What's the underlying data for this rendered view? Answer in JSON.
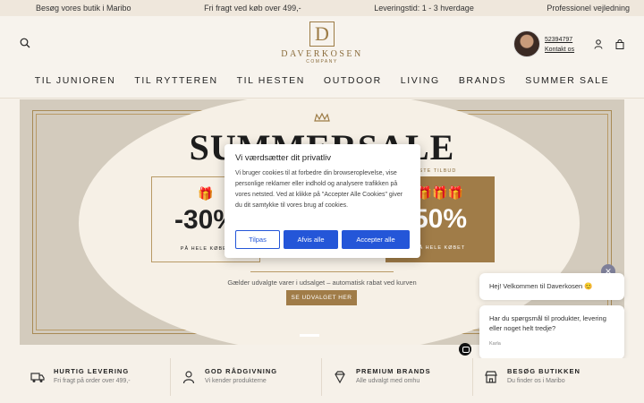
{
  "topbar": [
    "Besøg vores butik i Maribo",
    "Fri fragt ved køb over 499,-",
    "Leveringstid: 1 - 3 hverdage",
    "Professionel vejledning"
  ],
  "logo": {
    "mark": "D",
    "name": "DAVERKOSEN",
    "sub": "COMPANY"
  },
  "contact": {
    "phone": "52394797",
    "link": "Kontakt os"
  },
  "icons": {
    "search": "search-icon",
    "user": "user-icon",
    "cart": "cart-icon"
  },
  "nav": [
    "TIL JUNIOREN",
    "TIL RYTTEREN",
    "TIL HESTEN",
    "OUTDOOR",
    "LIVING",
    "BRANDS",
    "SUMMER SALE"
  ],
  "hero": {
    "title": "SUMMERSALE",
    "left_icon": "🎁",
    "left_value": "-30%",
    "left_caption": "PÅ HELE KØBET",
    "right_tag": "EDSTE TILBUD",
    "right_icon": "🎁🎁🎁",
    "right_value": "50%",
    "right_caption": "PÅ HELE KØBET",
    "note": "Gælder udvalgte varer i udsalget – automatisk rabat ved kurven",
    "cta": "SE UDVALGET HER"
  },
  "cookie": {
    "title": "Vi værdsætter dit privatliv",
    "body": "Vi bruger cookies til at forbedre din browseroplevelse, vise personlige reklamer eller indhold og analysere trafikken på vores netsted. Ved at klikke på \"Accepter Alle Cookies\" giver du dit samtykke til vores brug af cookies.",
    "customize": "Tilpas",
    "deny": "Afvis alle",
    "accept": "Accepter alle"
  },
  "chat": {
    "close": "✕",
    "greeting": "Hej! Velkommen til Daverkosen 😊",
    "question": "Har du spørgsmål til produkter, levering eller noget helt tredje?",
    "author": "Karla"
  },
  "features": [
    {
      "icon": "truck-icon",
      "title": "HURTIG LEVERING",
      "sub": "Fri fragt på order over 499,-"
    },
    {
      "icon": "person-icon",
      "title": "GOD RÅDGIVNING",
      "sub": "Vi kender produkterne"
    },
    {
      "icon": "diamond-icon",
      "title": "PREMIUM BRANDS",
      "sub": "Alle udvalgt med omhu"
    },
    {
      "icon": "store-icon",
      "title": "BESØG BUTIKKEN",
      "sub": "Du finder os i Maribo"
    }
  ],
  "colors": {
    "accent": "#a07c48",
    "button": "#2456d8",
    "background": "#f6f1e9"
  }
}
